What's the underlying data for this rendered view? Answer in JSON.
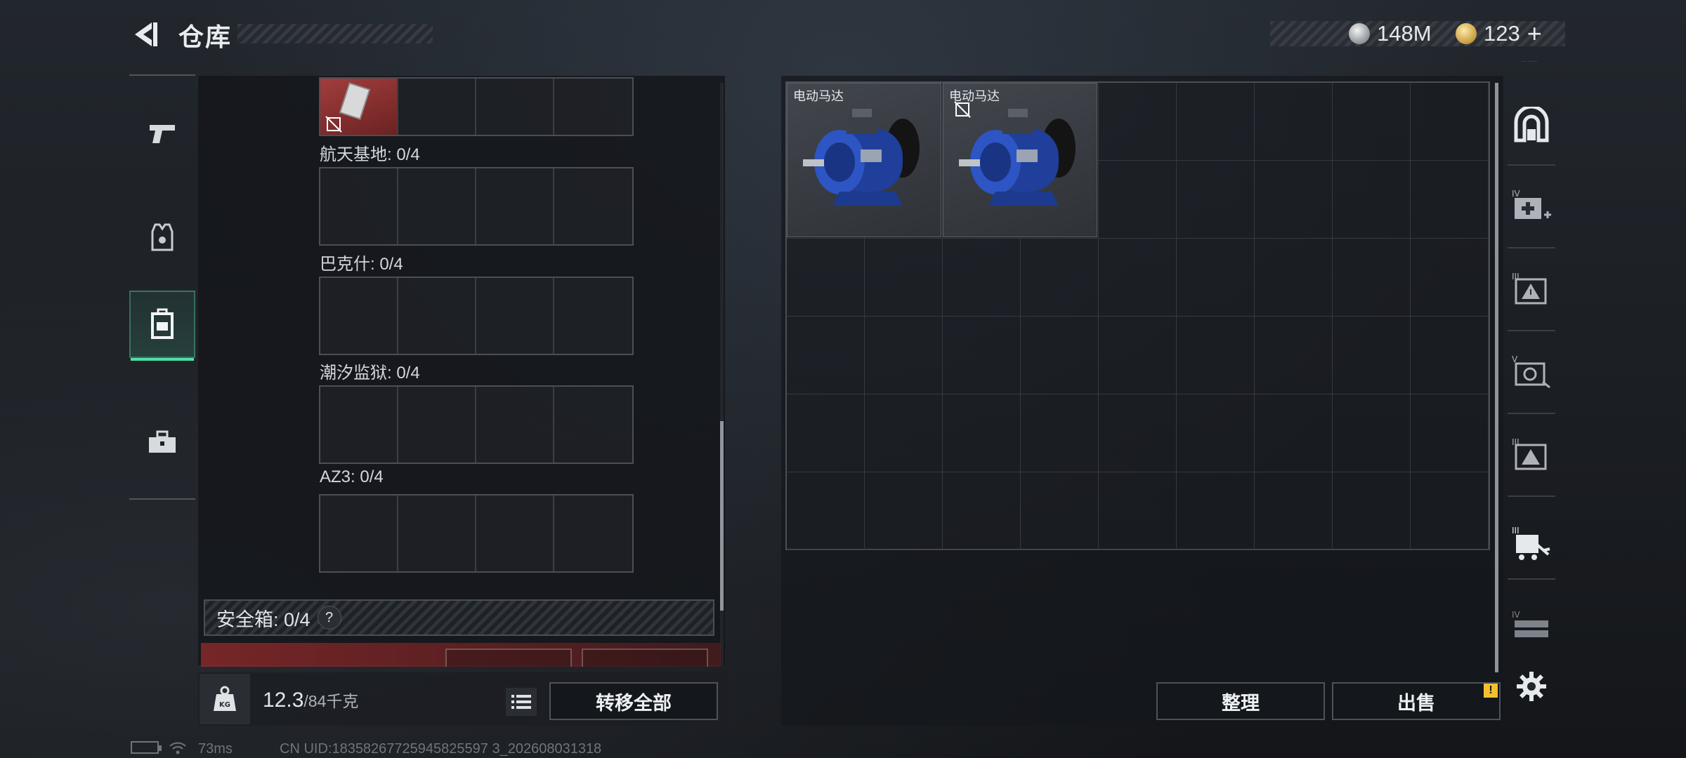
{
  "header": {
    "title": "仓库",
    "currency_silver": "148M",
    "currency_gold": "123",
    "gold_plus": "+",
    "version_text": "........"
  },
  "left_tabs": [
    {
      "name": "weapons",
      "icon": "pistol-icon"
    },
    {
      "name": "armor",
      "icon": "vest-icon"
    },
    {
      "name": "backpack",
      "icon": "backpack-icon",
      "active": true
    },
    {
      "name": "toolbox",
      "icon": "toolbox-icon"
    }
  ],
  "maps": [
    {
      "label": "航天基地: 0/4"
    },
    {
      "label": "巴克什: 0/4"
    },
    {
      "label": "潮汐监狱: 0/4"
    },
    {
      "label": "AZ3: 0/4"
    }
  ],
  "safebox": {
    "label": "安全箱: 0/4",
    "help": "?"
  },
  "weight": {
    "current": "12.3",
    "max": "/84千克",
    "icon_text": "KG"
  },
  "buttons": {
    "transfer_all": "转移全部",
    "sort": "整理",
    "sell": "出售",
    "warn": "!"
  },
  "stash_items": [
    {
      "label": "电动马达",
      "icon": "electric-motor-icon",
      "no_sell": false
    },
    {
      "label": "电动马达",
      "icon": "electric-motor-icon",
      "no_sell": true
    }
  ],
  "side_icons": [
    {
      "name": "side-tab-1",
      "icon": "arch-icon",
      "tier": ""
    },
    {
      "name": "side-tab-2",
      "icon": "medkit-icon",
      "tier": "IV"
    },
    {
      "name": "side-tab-3",
      "icon": "warning-box-icon",
      "tier": "III"
    },
    {
      "name": "side-tab-4",
      "icon": "safe-icon",
      "tier": "V"
    },
    {
      "name": "side-tab-5",
      "icon": "warning-box-icon",
      "tier": "III"
    },
    {
      "name": "side-tab-6",
      "icon": "cart-icon",
      "tier": "III"
    },
    {
      "name": "side-tab-7",
      "icon": "rack-icon",
      "tier": "IV"
    }
  ],
  "status": {
    "ping": "73ms",
    "uid": "CN UID:18358267725945825597 3_202608031318"
  },
  "colors": {
    "accent": "#4fe0a6",
    "warning": "#f5c02c",
    "motor_blue": "#1f3f9a"
  }
}
